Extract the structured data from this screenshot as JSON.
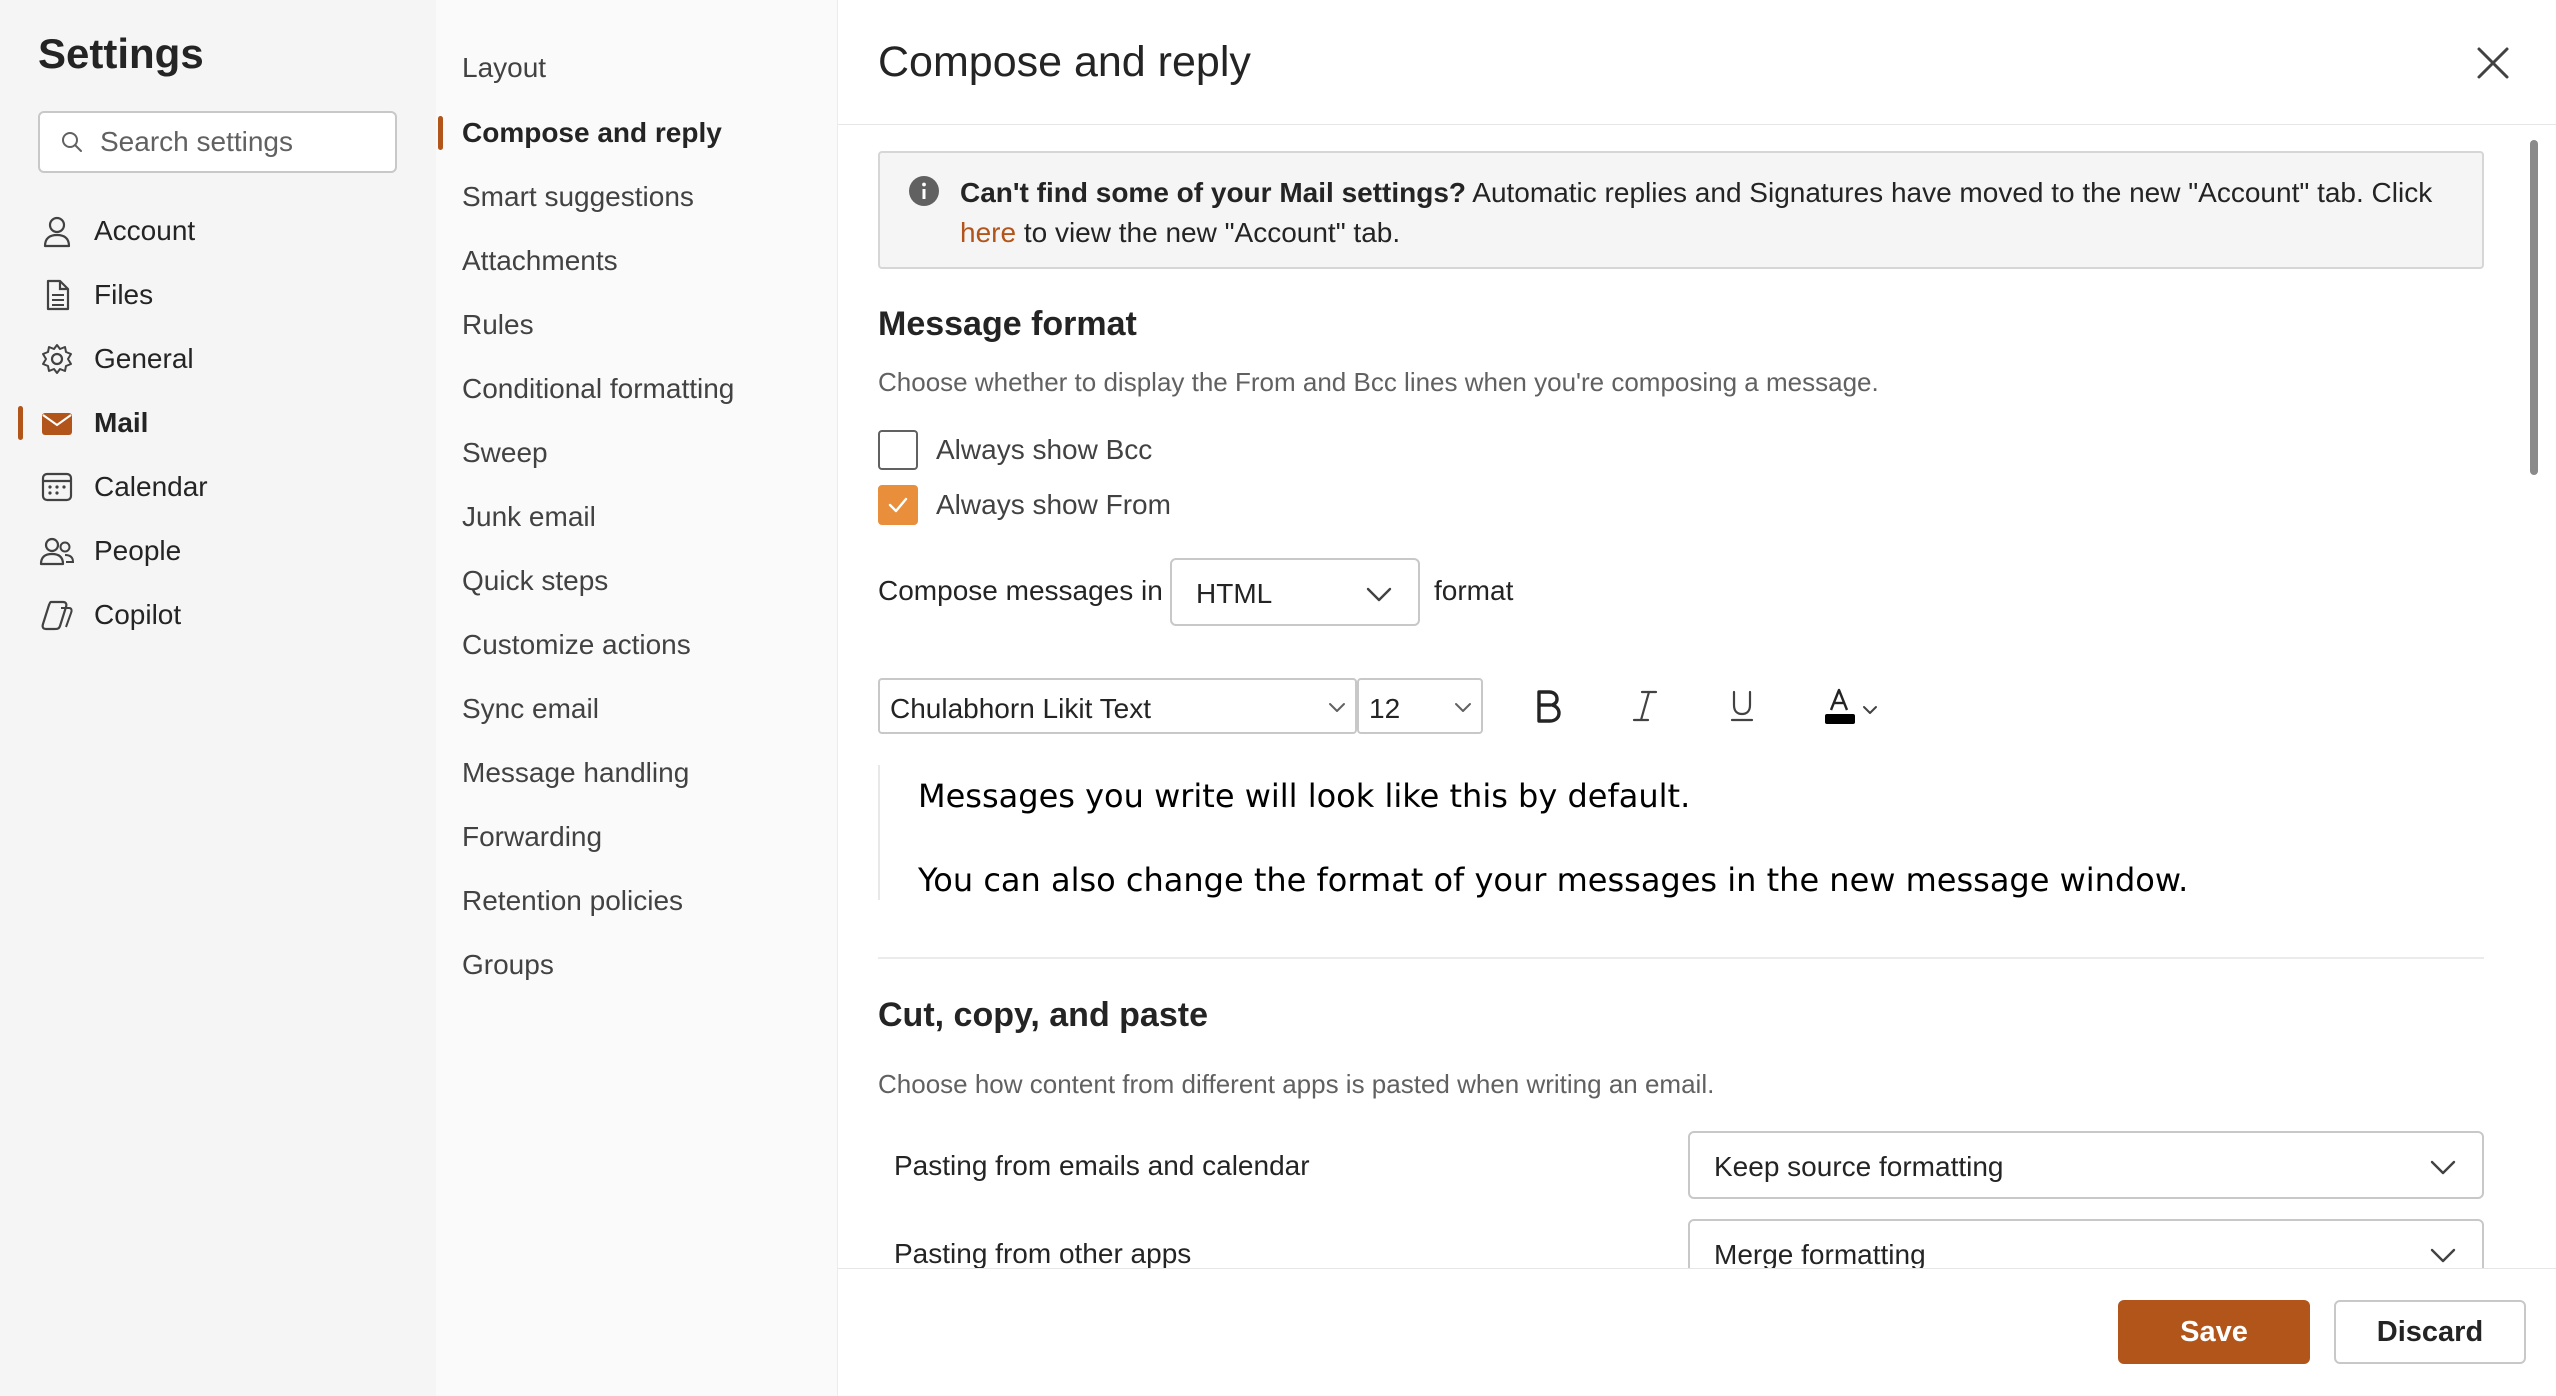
{
  "app": {
    "title": "Settings",
    "search": {
      "placeholder": "Search settings"
    }
  },
  "nav": {
    "items": [
      {
        "label": "Account",
        "icon": "person-icon"
      },
      {
        "label": "Files",
        "icon": "file-icon"
      },
      {
        "label": "General",
        "icon": "gear-icon"
      },
      {
        "label": "Mail",
        "icon": "mail-icon",
        "selected": true
      },
      {
        "label": "Calendar",
        "icon": "calendar-icon"
      },
      {
        "label": "People",
        "icon": "people-icon"
      },
      {
        "label": "Copilot",
        "icon": "copilot-icon"
      }
    ]
  },
  "subnav": {
    "items": [
      "Layout",
      "Compose and reply",
      "Smart suggestions",
      "Attachments",
      "Rules",
      "Conditional formatting",
      "Sweep",
      "Junk email",
      "Quick steps",
      "Customize actions",
      "Sync email",
      "Message handling",
      "Forwarding",
      "Retention policies",
      "Groups"
    ],
    "selected": "Compose and reply"
  },
  "pane": {
    "title": "Compose and reply",
    "banner": {
      "bold": "Can't find some of your Mail settings?",
      "text": " Automatic replies and Signatures have moved to the new \"Account\" tab. Click",
      "link": "here",
      "text2": " to view the new \"Account\" tab."
    },
    "message_format": {
      "title": "Message format",
      "description": "Choose whether to display the From and Bcc lines when you're composing a message.",
      "always_show_bcc": {
        "label": "Always show Bcc",
        "checked": false
      },
      "always_show_from": {
        "label": "Always show From",
        "checked": true
      },
      "compose_label": "Compose messages in",
      "compose_value": "HTML",
      "compose_suffix": "format",
      "font_family": "Chulabhorn Likit Text",
      "font_size": "12",
      "text_color": "#000000",
      "preview_line1": "Messages you write will look like this by default.",
      "preview_line2": "You can also change the format of your messages in the new message window."
    },
    "paste": {
      "title": "Cut, copy, and paste",
      "description": "Choose how content from different apps is pasted when writing an email.",
      "emails_label": "Pasting from emails and calendar",
      "emails_value": "Keep source formatting",
      "apps_label": "Pasting from other apps",
      "apps_value": "Merge formatting"
    },
    "footer": {
      "save": "Save",
      "discard": "Discard"
    }
  },
  "colors": {
    "accent": "#b2551a",
    "checkbox_checked": "#e98f3c",
    "nav_bg": "#f5f5f5"
  }
}
